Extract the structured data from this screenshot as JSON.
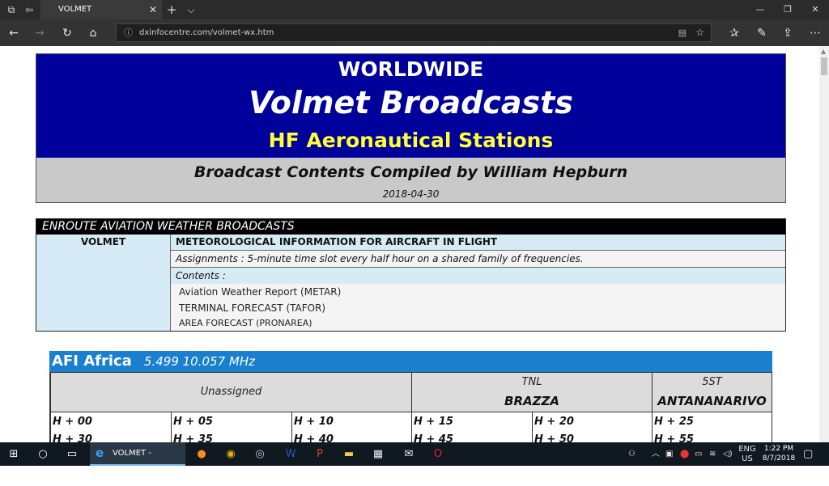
{
  "browser": {
    "tab_title": "VOLMET",
    "url": "dxinfocentre.com/volmet-wx.htm",
    "tab_close": "✕",
    "new_tab": "+",
    "tab_list": "⌵",
    "win_min": "—",
    "win_max": "❐",
    "win_close": "✕"
  },
  "banner": {
    "line1": "WORLDWIDE",
    "line2": "Volmet Broadcasts",
    "line3": "HF Aeronautical Stations",
    "line4": "Broadcast Contents Compiled by William Hepburn",
    "date": "2018-04-30"
  },
  "enroute": {
    "header": "ENROUTE  AVIATION WEATHER BROADCASTS",
    "label": "VOLMET",
    "title": "METEOROLOGICAL INFORMATION FOR AIRCRAFT IN FLIGHT",
    "assignments": "Assignments : 5-minute time slot every half hour on a shared family of frequencies.",
    "contents_label": "Contents :",
    "contents": [
      "Aviation Weather Report  (METAR)",
      "TERMINAL FORECAST  (TAFOR)",
      "AREA FORECAST  (PRONAREA)"
    ]
  },
  "africa": {
    "region": "AFI  Africa",
    "freqs": "5.499  10.057  MHz",
    "unassigned": "Unassigned",
    "stations": [
      {
        "code": "TNL",
        "name": "BRAZZA"
      },
      {
        "code": "5ST",
        "name": "ANTANANARIVO"
      }
    ],
    "slots": [
      {
        "a": "H + 00",
        "b": "H + 30"
      },
      {
        "a": "H + 05",
        "b": "H + 35"
      },
      {
        "a": "H + 10",
        "b": "H + 40"
      },
      {
        "a": "H + 15",
        "b": "H + 45"
      },
      {
        "a": "H + 20",
        "b": "H + 50"
      },
      {
        "a": "H + 25",
        "b": "H + 55"
      }
    ]
  },
  "taskbar": {
    "active_app": "VOLMET - Microso...",
    "lang_top": "ENG",
    "lang_bottom": "US",
    "time": "1:22 PM",
    "date": "8/7/2018"
  },
  "colors": {
    "banner_blue": "#00009a",
    "banner_yellow": "#ffff33",
    "region_blue": "#1a7fce",
    "light_blue_cell": "#d6ebf5"
  },
  "icons": [
    "back-icon",
    "forward-icon",
    "refresh-icon",
    "home-icon",
    "favorites-icon",
    "pen-icon",
    "share-icon",
    "more-icon",
    "windows-icon",
    "search-icon",
    "task-view-icon"
  ]
}
